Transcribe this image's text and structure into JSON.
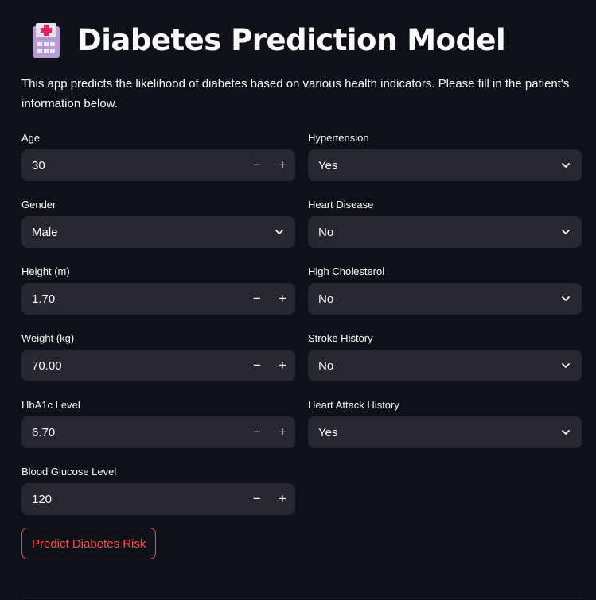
{
  "header": {
    "title": "Diabetes Prediction Model",
    "icon": "hospital-icon"
  },
  "description": "This app predicts the likelihood of diabetes based on various health indicators. Please fill in the patient's information below.",
  "left_fields": [
    {
      "label": "Age",
      "value": "30",
      "type": "number"
    },
    {
      "label": "Gender",
      "value": "Male",
      "type": "select"
    },
    {
      "label": "Height (m)",
      "value": "1.70",
      "type": "number"
    },
    {
      "label": "Weight (kg)",
      "value": "70.00",
      "type": "number"
    },
    {
      "label": "HbA1c Level",
      "value": "6.70",
      "type": "number"
    },
    {
      "label": "Blood Glucose Level",
      "value": "120",
      "type": "number"
    }
  ],
  "right_fields": [
    {
      "label": "Hypertension",
      "value": "Yes",
      "type": "select"
    },
    {
      "label": "Heart Disease",
      "value": "No",
      "type": "select"
    },
    {
      "label": "High Cholesterol",
      "value": "No",
      "type": "select"
    },
    {
      "label": "Stroke History",
      "value": "No",
      "type": "select"
    },
    {
      "label": "Heart Attack History",
      "value": "Yes",
      "type": "select"
    }
  ],
  "stepper": {
    "minus": "−",
    "plus": "+"
  },
  "predict_button": "Predict Diabetes Risk",
  "colors": {
    "background": "#0e1117",
    "input_bg": "#262730",
    "text": "#fafafa",
    "accent": "#ff4b4b"
  }
}
